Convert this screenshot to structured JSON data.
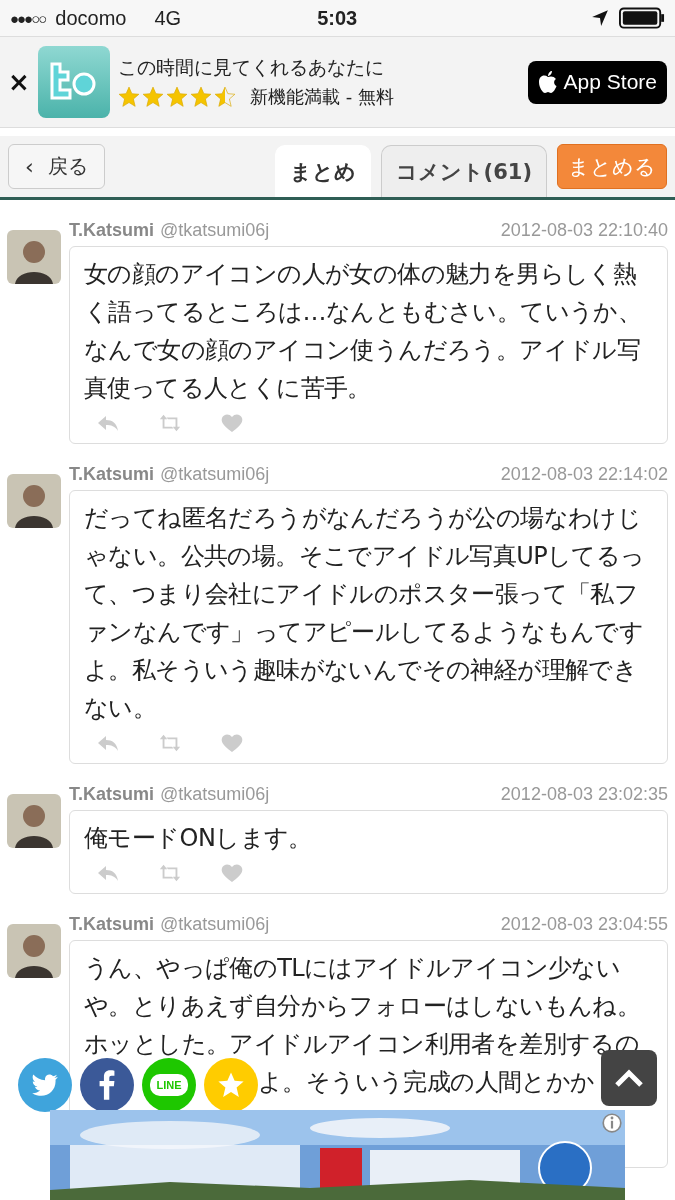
{
  "status_bar": {
    "signal": "●●●○○",
    "carrier": "docomo",
    "network": "4G",
    "time": "5:03"
  },
  "ad": {
    "close": "×",
    "title": "この時間に見てくれるあなたに",
    "stars": 4.5,
    "subtitle": "新機能満載 - 無料",
    "store_button": "App Store"
  },
  "nav": {
    "back": "戻る",
    "back_chevron": "‹",
    "tabs": [
      {
        "label": "まとめ",
        "selected": true
      },
      {
        "label": "コメント(61)",
        "selected": false
      }
    ],
    "action": "まとめる"
  },
  "tweets": [
    {
      "name": "T.Katsumi",
      "handle": "@tkatsumi06j",
      "time": "2012-08-03 22:10:40",
      "text": "女の顔のアイコンの人が女の体の魅力を男らしく熱く語ってるところは…なんともむさい。ていうか、なんで女の顔のアイコン使うんだろう。アイドル写真使ってる人とくに苦手。"
    },
    {
      "name": "T.Katsumi",
      "handle": "@tkatsumi06j",
      "time": "2012-08-03 22:14:02",
      "text": "だってね匿名だろうがなんだろうが公の場なわけじゃない。公共の場。そこでアイドル写真UPしてるって、つまり会社にアイドルのポスター張って「私ファンなんです」ってアピールしてるようなもんですよ。私そういう趣味がないんでその神経が理解できない。"
    },
    {
      "name": "T.Katsumi",
      "handle": "@tkatsumi06j",
      "time": "2012-08-03 23:02:35",
      "text": "俺モードONします。"
    },
    {
      "name": "T.Katsumi",
      "handle": "@tkatsumi06j",
      "time": "2012-08-03 23:04:55",
      "text": "うん、やっぱ俺のTLにはアイドルアイコン少ないや。とりあえず自分からフォローはしないもんね。ホッとした。アイドルアイコン利用者を差別するの",
      "text_after_overlay": "よ。そういう完成の人間とかか"
    }
  ],
  "share": [
    {
      "kind": "twitter"
    },
    {
      "kind": "facebook"
    },
    {
      "kind": "line",
      "label": "LINE"
    },
    {
      "kind": "favorite"
    }
  ]
}
